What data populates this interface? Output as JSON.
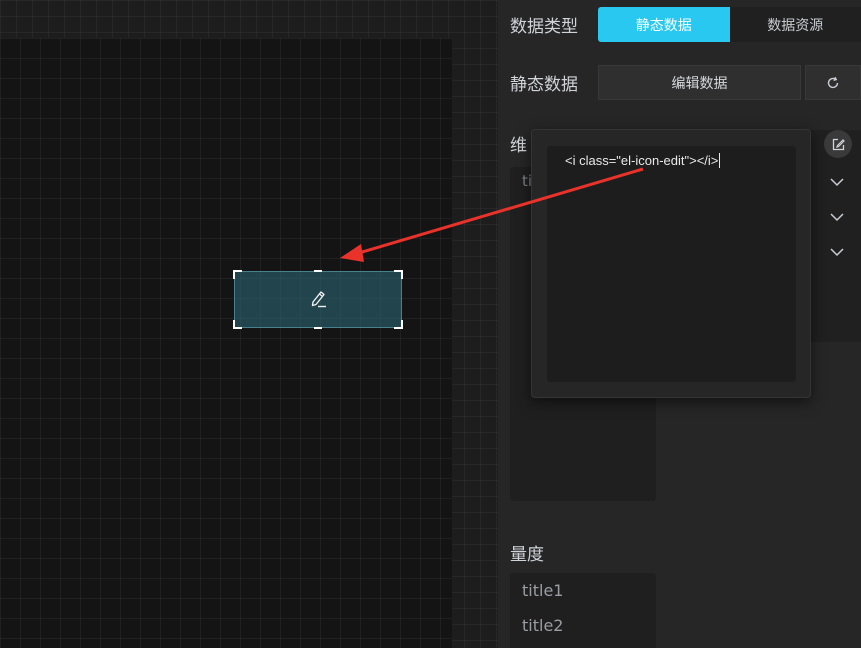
{
  "panel": {
    "data_type_label": "数据类型",
    "data_type_tabs": [
      {
        "label": "静态数据",
        "active": true
      },
      {
        "label": "数据资源",
        "active": false
      }
    ],
    "static_data_label": "静态数据",
    "edit_data_button": "编辑数据",
    "refresh_icon": "refresh-icon",
    "dimension_label_partial": "维",
    "dimension_items_partial": [
      "ti"
    ],
    "edit_icon": "edit-icon",
    "measure_label": "量度",
    "measure_items": [
      "title1",
      "title2"
    ],
    "accent_color": "#28c8f0"
  },
  "popover": {
    "editor_value": "<i class=\"el-icon-edit\"></i>"
  },
  "canvas": {
    "widget_icon": "edit-pencil-icon"
  },
  "annotation": {
    "color": "#e8322a"
  }
}
